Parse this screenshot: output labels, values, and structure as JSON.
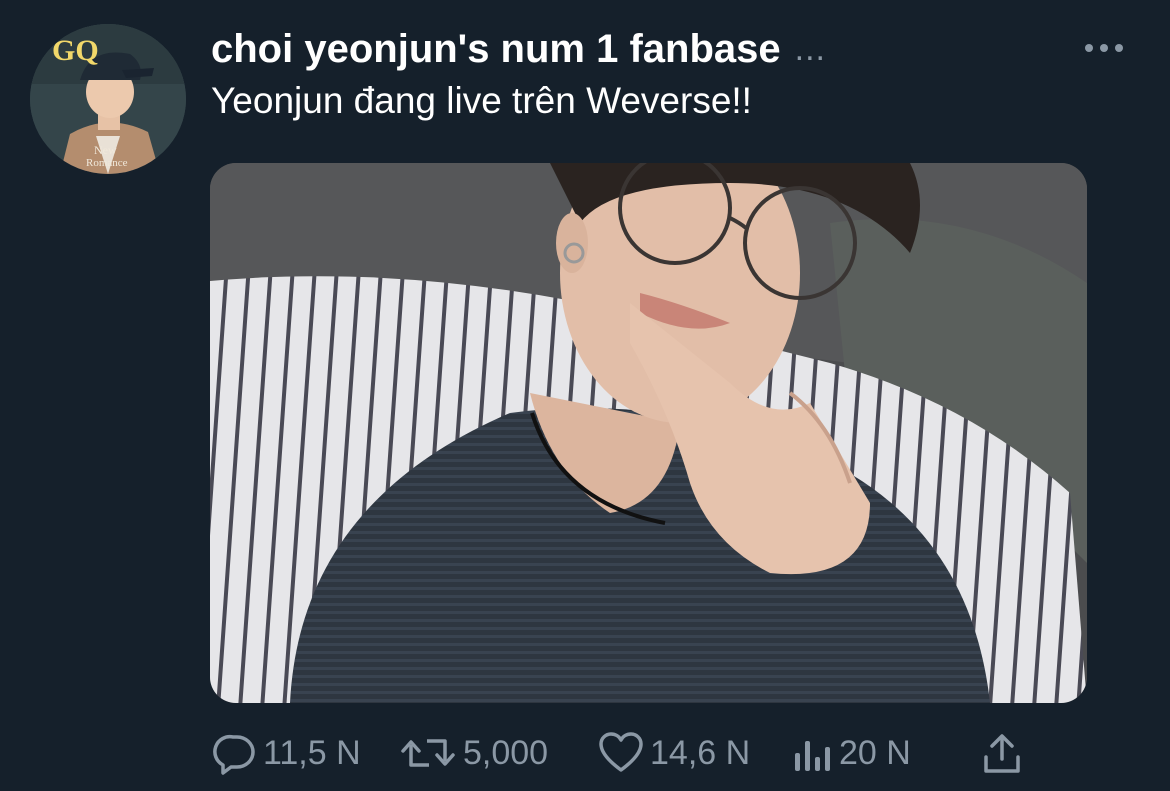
{
  "account": {
    "display_name": "choi yeonjun's num 1 fanbase",
    "name_truncation": "...",
    "avatar_icon": "profile-photo",
    "avatar_text": {
      "logo": "GQ",
      "cover_line_1": "New",
      "cover_line_2": "Romance"
    }
  },
  "tweet": {
    "text": "Yeonjun đang live trên Weverse!!",
    "media_icon": "photo"
  },
  "actions": {
    "reply_count": "11,5 N",
    "retweet_count": "5,000",
    "like_count": "14,6 N",
    "views_count": "20 N"
  },
  "icons": {
    "more": "more-horizontal-icon",
    "reply": "reply-icon",
    "retweet": "retweet-icon",
    "like": "heart-icon",
    "views": "views-icon",
    "share": "share-icon"
  },
  "colors": {
    "background": "#15202b",
    "text_primary": "#ffffff",
    "text_secondary": "#8b98a5"
  }
}
